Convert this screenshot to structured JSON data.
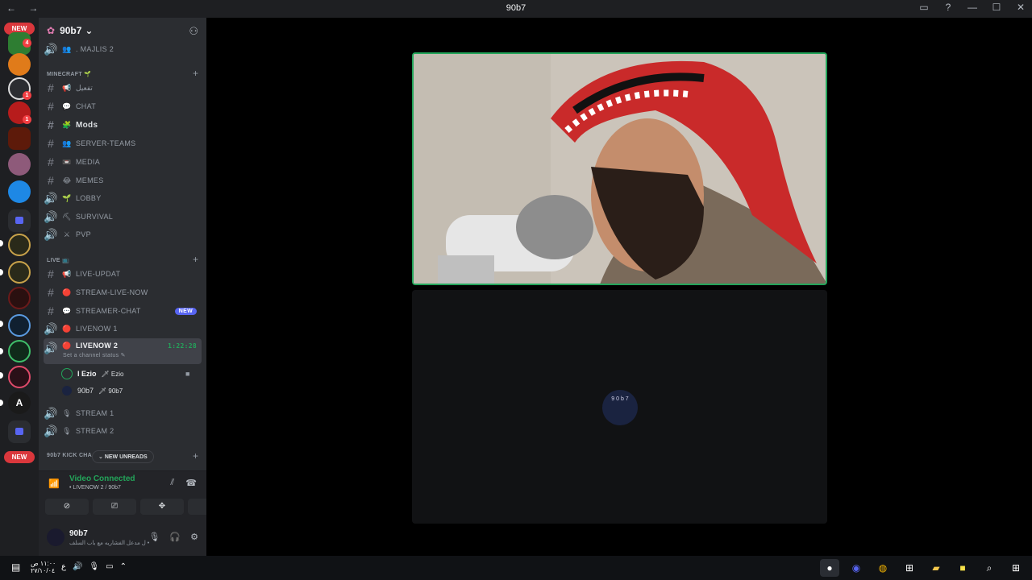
{
  "window": {
    "title": "90b7",
    "nav": "← →"
  },
  "server_rail": {
    "new_top": "NEW",
    "new_bottom": "NEW",
    "badges": [
      "4",
      "1",
      "1"
    ]
  },
  "sidebar": {
    "server_name": "90b7",
    "top_channel": ". MAJLIS 2",
    "categories": {
      "minecraft": "MINECRAFT 🌱",
      "live": "LIVE 📺",
      "kick": "90b7 KICK CHA"
    },
    "channels": [
      {
        "label": "تفعيل",
        "emoji": "📢",
        "type": "text"
      },
      {
        "label": "CHAT",
        "emoji": "💬",
        "type": "text"
      },
      {
        "label": "Mods",
        "emoji": "🧩",
        "type": "text"
      },
      {
        "label": "SERVER-TEAMS",
        "emoji": "👥",
        "type": "text"
      },
      {
        "label": "MEDIA",
        "emoji": "📼",
        "type": "text"
      },
      {
        "label": "MEMES",
        "emoji": "😂",
        "type": "text"
      },
      {
        "label": "LOBBY",
        "emoji": "🌱",
        "type": "voice"
      },
      {
        "label": "SURVIVAL",
        "emoji": "⛏",
        "type": "voice"
      },
      {
        "label": "PVP",
        "emoji": "⚔",
        "type": "voice"
      },
      {
        "label": "LIVE-UPDAT",
        "emoji": "📢",
        "type": "text"
      },
      {
        "label": "STREAM-LIVE-NOW",
        "emoji": "🔴",
        "type": "text"
      },
      {
        "label": "STREAMER-CHAT",
        "emoji": "💬",
        "type": "text",
        "tag": "NEW"
      },
      {
        "label": "LIVENOW 1",
        "emoji": "🔴",
        "type": "voice"
      },
      {
        "label": "LIVENOW 2",
        "emoji": "🔴",
        "type": "voice",
        "active": true
      },
      {
        "label": "STREAM 1",
        "emoji": "🎙",
        "type": "voice"
      },
      {
        "label": "STREAM 2",
        "emoji": "🎙",
        "type": "voice"
      }
    ],
    "active_timer": "1:22:28",
    "active_status": "Set a channel status ✎",
    "voice_users": [
      {
        "name": "I Ezio",
        "tag": "🗡 Ezio"
      },
      {
        "name": "90b7",
        "tag": "🗡 90b7"
      }
    ],
    "new_unreads": "NEW UNREADS"
  },
  "voice_panel": {
    "status": "Video Connected",
    "location": "• LIVENOW 2 / 90b7"
  },
  "user_panel": {
    "name": "90b7",
    "status": "ل مدعل الفشاريه مع باب السلف •"
  },
  "stage": {
    "avatar_text": "9 0 b 7"
  },
  "taskbar": {
    "time": "١١:٠٠ ص",
    "date": "٢٧/١٠/٠٤"
  },
  "colors": {
    "accent_green": "#23a55a",
    "brand": "#5865f2",
    "danger": "#da373c"
  }
}
